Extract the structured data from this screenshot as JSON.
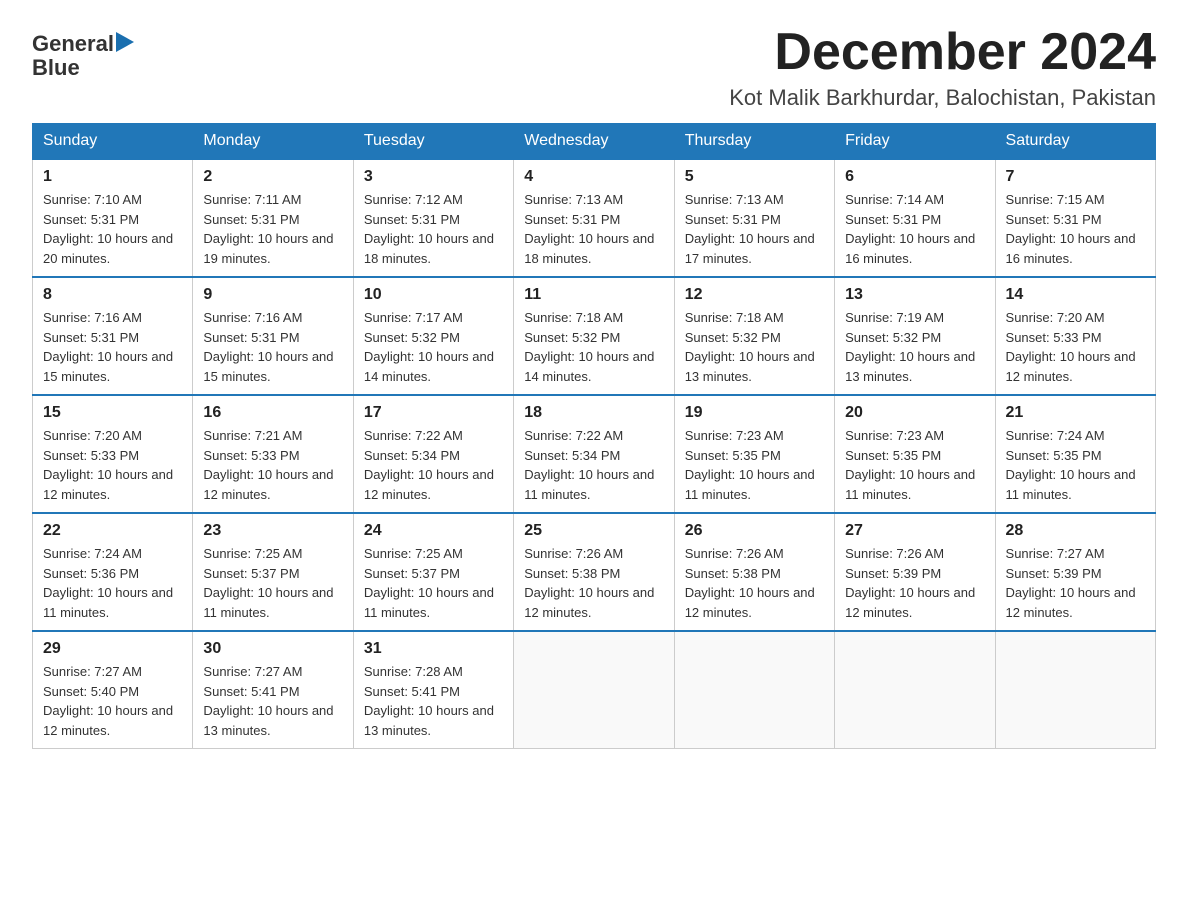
{
  "header": {
    "logo_line1": "General",
    "logo_line2": "Blue",
    "month_title": "December 2024",
    "location": "Kot Malik Barkhurdar, Balochistan, Pakistan"
  },
  "days_of_week": [
    "Sunday",
    "Monday",
    "Tuesday",
    "Wednesday",
    "Thursday",
    "Friday",
    "Saturday"
  ],
  "weeks": [
    [
      {
        "day": "1",
        "sunrise": "7:10 AM",
        "sunset": "5:31 PM",
        "daylight": "10 hours and 20 minutes."
      },
      {
        "day": "2",
        "sunrise": "7:11 AM",
        "sunset": "5:31 PM",
        "daylight": "10 hours and 19 minutes."
      },
      {
        "day": "3",
        "sunrise": "7:12 AM",
        "sunset": "5:31 PM",
        "daylight": "10 hours and 18 minutes."
      },
      {
        "day": "4",
        "sunrise": "7:13 AM",
        "sunset": "5:31 PM",
        "daylight": "10 hours and 18 minutes."
      },
      {
        "day": "5",
        "sunrise": "7:13 AM",
        "sunset": "5:31 PM",
        "daylight": "10 hours and 17 minutes."
      },
      {
        "day": "6",
        "sunrise": "7:14 AM",
        "sunset": "5:31 PM",
        "daylight": "10 hours and 16 minutes."
      },
      {
        "day": "7",
        "sunrise": "7:15 AM",
        "sunset": "5:31 PM",
        "daylight": "10 hours and 16 minutes."
      }
    ],
    [
      {
        "day": "8",
        "sunrise": "7:16 AM",
        "sunset": "5:31 PM",
        "daylight": "10 hours and 15 minutes."
      },
      {
        "day": "9",
        "sunrise": "7:16 AM",
        "sunset": "5:31 PM",
        "daylight": "10 hours and 15 minutes."
      },
      {
        "day": "10",
        "sunrise": "7:17 AM",
        "sunset": "5:32 PM",
        "daylight": "10 hours and 14 minutes."
      },
      {
        "day": "11",
        "sunrise": "7:18 AM",
        "sunset": "5:32 PM",
        "daylight": "10 hours and 14 minutes."
      },
      {
        "day": "12",
        "sunrise": "7:18 AM",
        "sunset": "5:32 PM",
        "daylight": "10 hours and 13 minutes."
      },
      {
        "day": "13",
        "sunrise": "7:19 AM",
        "sunset": "5:32 PM",
        "daylight": "10 hours and 13 minutes."
      },
      {
        "day": "14",
        "sunrise": "7:20 AM",
        "sunset": "5:33 PM",
        "daylight": "10 hours and 12 minutes."
      }
    ],
    [
      {
        "day": "15",
        "sunrise": "7:20 AM",
        "sunset": "5:33 PM",
        "daylight": "10 hours and 12 minutes."
      },
      {
        "day": "16",
        "sunrise": "7:21 AM",
        "sunset": "5:33 PM",
        "daylight": "10 hours and 12 minutes."
      },
      {
        "day": "17",
        "sunrise": "7:22 AM",
        "sunset": "5:34 PM",
        "daylight": "10 hours and 12 minutes."
      },
      {
        "day": "18",
        "sunrise": "7:22 AM",
        "sunset": "5:34 PM",
        "daylight": "10 hours and 11 minutes."
      },
      {
        "day": "19",
        "sunrise": "7:23 AM",
        "sunset": "5:35 PM",
        "daylight": "10 hours and 11 minutes."
      },
      {
        "day": "20",
        "sunrise": "7:23 AM",
        "sunset": "5:35 PM",
        "daylight": "10 hours and 11 minutes."
      },
      {
        "day": "21",
        "sunrise": "7:24 AM",
        "sunset": "5:35 PM",
        "daylight": "10 hours and 11 minutes."
      }
    ],
    [
      {
        "day": "22",
        "sunrise": "7:24 AM",
        "sunset": "5:36 PM",
        "daylight": "10 hours and 11 minutes."
      },
      {
        "day": "23",
        "sunrise": "7:25 AM",
        "sunset": "5:37 PM",
        "daylight": "10 hours and 11 minutes."
      },
      {
        "day": "24",
        "sunrise": "7:25 AM",
        "sunset": "5:37 PM",
        "daylight": "10 hours and 11 minutes."
      },
      {
        "day": "25",
        "sunrise": "7:26 AM",
        "sunset": "5:38 PM",
        "daylight": "10 hours and 12 minutes."
      },
      {
        "day": "26",
        "sunrise": "7:26 AM",
        "sunset": "5:38 PM",
        "daylight": "10 hours and 12 minutes."
      },
      {
        "day": "27",
        "sunrise": "7:26 AM",
        "sunset": "5:39 PM",
        "daylight": "10 hours and 12 minutes."
      },
      {
        "day": "28",
        "sunrise": "7:27 AM",
        "sunset": "5:39 PM",
        "daylight": "10 hours and 12 minutes."
      }
    ],
    [
      {
        "day": "29",
        "sunrise": "7:27 AM",
        "sunset": "5:40 PM",
        "daylight": "10 hours and 12 minutes."
      },
      {
        "day": "30",
        "sunrise": "7:27 AM",
        "sunset": "5:41 PM",
        "daylight": "10 hours and 13 minutes."
      },
      {
        "day": "31",
        "sunrise": "7:28 AM",
        "sunset": "5:41 PM",
        "daylight": "10 hours and 13 minutes."
      },
      null,
      null,
      null,
      null
    ]
  ]
}
